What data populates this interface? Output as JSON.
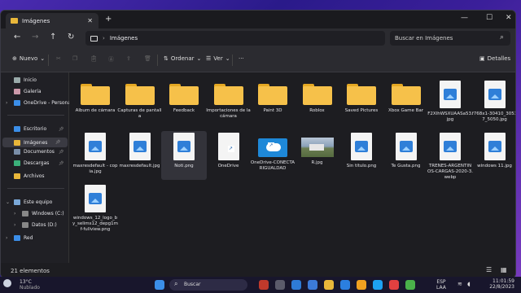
{
  "window": {
    "tab_title": "Imágenes",
    "new_tab": "+",
    "min": "—",
    "max": "☐",
    "close": "✕"
  },
  "nav": {
    "breadcrumb": "Imágenes",
    "search_placeholder": "Buscar en Imágenes"
  },
  "command_bar": {
    "new_label": "Nuevo",
    "sort_label": "Ordenar",
    "view_label": "Ver",
    "more_label": "···",
    "details_label": "Detalles"
  },
  "sidebar": {
    "items": [
      {
        "label": "Inicio",
        "icon": "home-icon"
      },
      {
        "label": "Galería",
        "icon": "gallery-icon"
      },
      {
        "label": "OneDrive - Persona",
        "icon": "onedrive-icon"
      },
      {
        "label": "Escritorio",
        "icon": "desktop-icon"
      },
      {
        "label": "Imágenes",
        "icon": "pictures-icon"
      },
      {
        "label": "Documentos",
        "icon": "documents-icon"
      },
      {
        "label": "Descargas",
        "icon": "downloads-icon"
      },
      {
        "label": "Archivos",
        "icon": "folder-icon"
      },
      {
        "label": "Este equipo",
        "icon": "pc-icon"
      },
      {
        "label": "Windows (C:)",
        "icon": "drive-icon"
      },
      {
        "label": "Datos (D:)",
        "icon": "drive-icon"
      },
      {
        "label": "Red",
        "icon": "network-icon"
      }
    ]
  },
  "files": [
    {
      "name": "Álbum de cámara",
      "kind": "folder"
    },
    {
      "name": "Capturas de pantalla",
      "kind": "folder"
    },
    {
      "name": "Feedback",
      "kind": "folder"
    },
    {
      "name": "Importaciones de la cámara",
      "kind": "folder"
    },
    {
      "name": "Paint 3D",
      "kind": "folder"
    },
    {
      "name": "Roblox",
      "kind": "folder"
    },
    {
      "name": "Saved Pictures",
      "kind": "folder"
    },
    {
      "name": "Xbox Game Bar",
      "kind": "folder"
    },
    {
      "name": "F2XlhWSXUAASa53.jpg",
      "kind": "image"
    },
    {
      "name": "f768x1-30410_30537_5050.jpg",
      "kind": "image"
    },
    {
      "name": "maxresdefault - copia.jpg",
      "kind": "image"
    },
    {
      "name": "maxresdefault.jpg",
      "kind": "image"
    },
    {
      "name": "Noti.png",
      "kind": "image"
    },
    {
      "name": "OneDrive",
      "kind": "shortcut"
    },
    {
      "name": "OneDrive-CONECTARIGUALDAD",
      "kind": "onedrive"
    },
    {
      "name": "R.jpg",
      "kind": "photo"
    },
    {
      "name": "Sin título.png",
      "kind": "image"
    },
    {
      "name": "Te Gusta.png",
      "kind": "image"
    },
    {
      "name": "TRENES-ARGENTINOS-CARGAS-2020-3.webp",
      "kind": "webp"
    },
    {
      "name": "windows 11.jpg",
      "kind": "image"
    },
    {
      "name": "windows_12_logo_by_selims12_depg1mf-fullview.png",
      "kind": "image"
    }
  ],
  "status": {
    "count": "21 elementos"
  },
  "taskbar": {
    "weather_temp": "13°C",
    "weather_desc": "Nublado",
    "search": "Buscar",
    "lang1": "ESP",
    "lang2": "LAA",
    "time": "11:01:59",
    "date": "22/8/2023"
  }
}
